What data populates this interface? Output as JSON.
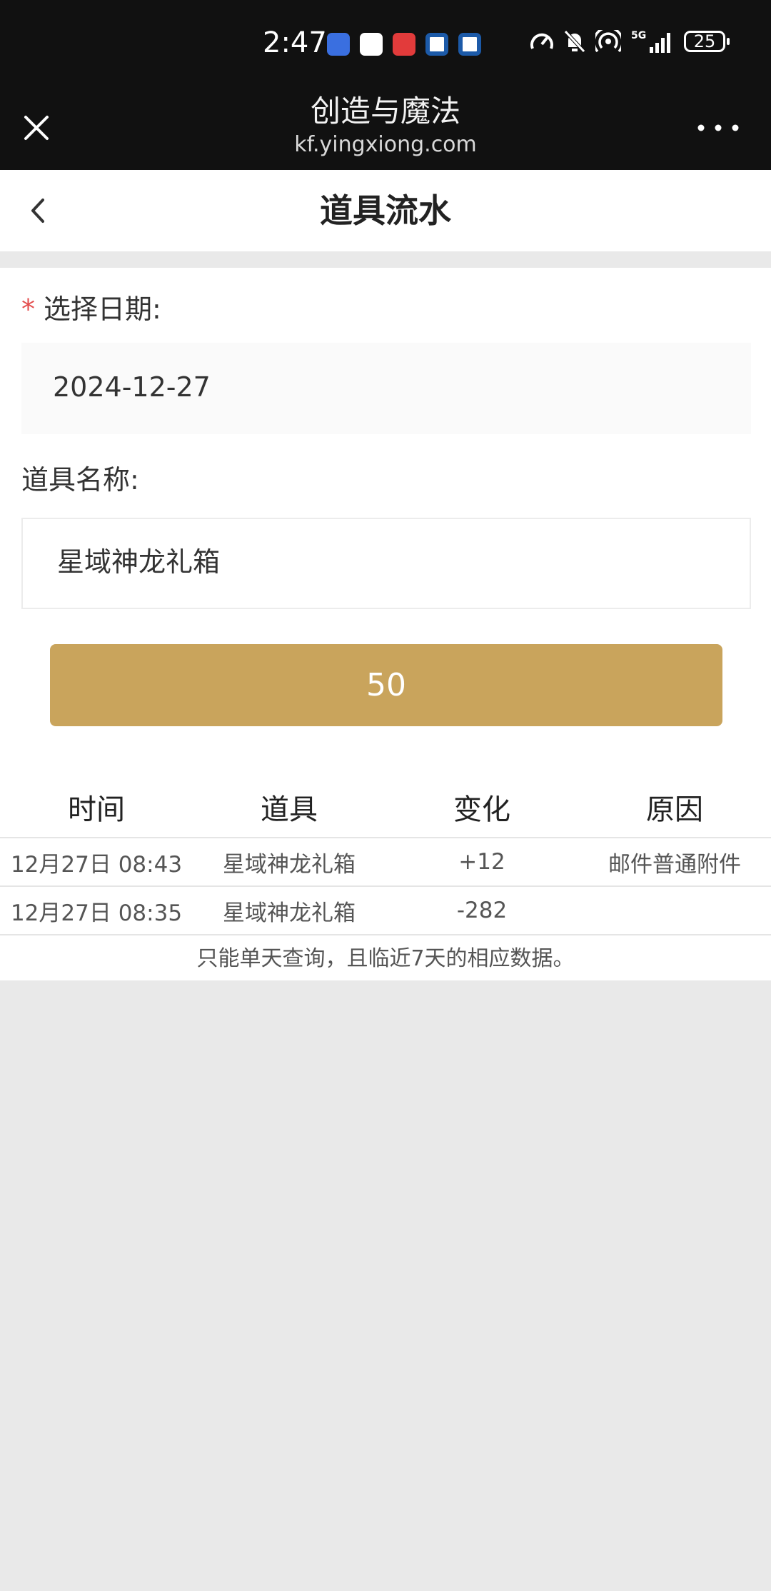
{
  "status_bar": {
    "time": "2:47",
    "battery": "25",
    "network": "5G"
  },
  "webview": {
    "title": "创造与魔法",
    "url": "kf.yingxiong.com"
  },
  "nav": {
    "title": "道具流水"
  },
  "form": {
    "date_label": "选择日期:",
    "required_mark": "*",
    "date_value": "2024-12-27",
    "item_label": "道具名称:",
    "item_value": "星域神龙礼箱",
    "submit_label": "50"
  },
  "table": {
    "headers": [
      "时间",
      "道具",
      "变化",
      "原因"
    ],
    "rows": [
      {
        "time": "12月27日 08:43",
        "item": "星域神龙礼箱",
        "change": "+12",
        "reason": "邮件普通附件"
      },
      {
        "time": "12月27日 08:35",
        "item": "星域神龙礼箱",
        "change": "-282",
        "reason": ""
      }
    ],
    "note": "只能单天查询，且临近7天的相应数据。"
  },
  "colors": {
    "accent": "#c9a45c",
    "required": "#e34d4d",
    "header_bg": "#111111",
    "page_bg": "#e9e9e9"
  }
}
